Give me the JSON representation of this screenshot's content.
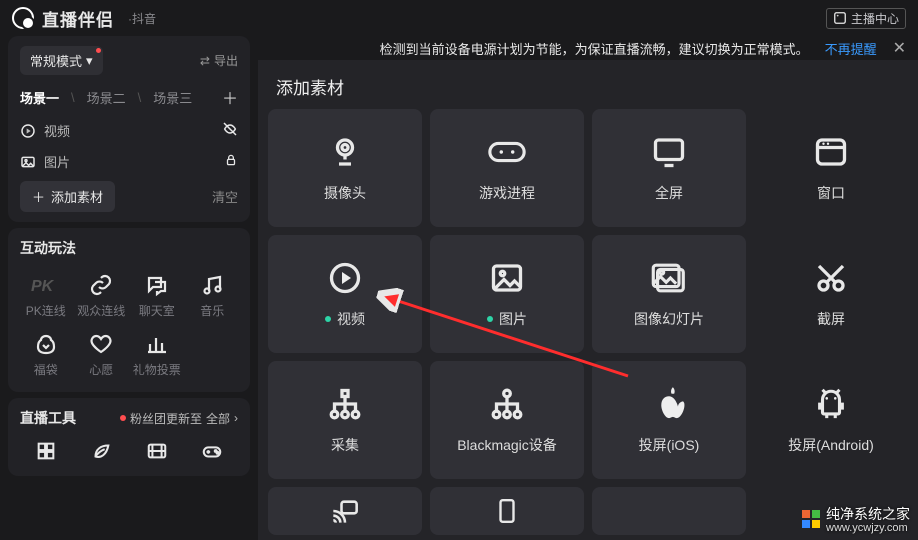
{
  "app": {
    "name": "直播伴侣",
    "sub": "·抖音"
  },
  "topbar": {
    "host_center": "主播中心"
  },
  "sidebar": {
    "mode_label": "常规模式",
    "swap_label": "导出",
    "scenes": [
      "场景一",
      "场景二",
      "场景三"
    ],
    "active_scene": 0,
    "sources": [
      {
        "icon": "play",
        "label": "视频",
        "locked": false,
        "hidden": true
      },
      {
        "icon": "image",
        "label": "图片",
        "locked": true,
        "hidden": false
      }
    ],
    "add_source": "添加素材",
    "clear": "清空",
    "interactive": {
      "title": "互动玩法",
      "items": [
        "PK连线",
        "观众连线",
        "聊天室",
        "音乐",
        "福袋",
        "心愿",
        "礼物投票",
        ""
      ]
    },
    "tools": {
      "title": "直播工具",
      "fans_note": "粉丝团更新至",
      "fans_all": "全部"
    }
  },
  "warning": {
    "text": "检测到当前设备电源计划为节能，为保证直播流畅，建议切换为正常模式。",
    "link": "不再提醒"
  },
  "modal": {
    "title": "添加素材",
    "rows": [
      [
        {
          "id": "camera",
          "label": "摄像头",
          "dot": false
        },
        {
          "id": "game",
          "label": "游戏进程",
          "dot": false
        },
        {
          "id": "fullscreen",
          "label": "全屏",
          "dot": false
        },
        {
          "id": "window",
          "label": "窗口",
          "dot": false
        }
      ],
      [
        {
          "id": "video",
          "label": "视频",
          "dot": true
        },
        {
          "id": "image",
          "label": "图片",
          "dot": true
        },
        {
          "id": "slideshow",
          "label": "图像幻灯片",
          "dot": false
        },
        {
          "id": "screenshot",
          "label": "截屏",
          "dot": false
        }
      ],
      [
        {
          "id": "capture",
          "label": "采集",
          "dot": false
        },
        {
          "id": "blackmagic",
          "label": "Blackmagic设备",
          "dot": false
        },
        {
          "id": "ios",
          "label": "投屏(iOS)",
          "dot": false
        },
        {
          "id": "android",
          "label": "投屏(Android)",
          "dot": false
        }
      ]
    ]
  },
  "watermark": {
    "title": "纯净系统之家",
    "url": "www.ycwjzy.com"
  }
}
